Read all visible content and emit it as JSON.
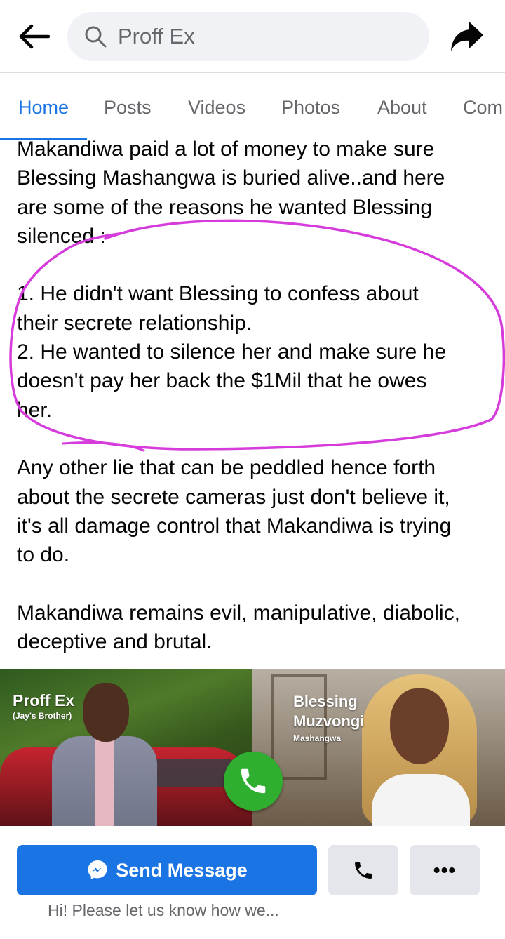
{
  "header": {
    "back_icon": "arrow-left-icon",
    "search_icon": "search-icon",
    "search_text": "Proff Ex",
    "share_icon": "share-arrow-icon"
  },
  "tabs": [
    {
      "label": "Home",
      "active": true
    },
    {
      "label": "Posts",
      "active": false
    },
    {
      "label": "Videos",
      "active": false
    },
    {
      "label": "Photos",
      "active": false
    },
    {
      "label": "About",
      "active": false
    },
    {
      "label": "Com",
      "active": false
    }
  ],
  "post": {
    "intro_lines": [
      "Makandiwa paid a lot of money to make sure",
      "Blessing Mashangwa is buried alive..and here",
      "are some of the reasons he wanted Blessing",
      "silenced :"
    ],
    "list_lines": [
      "1. He didn't want Blessing to confess about",
      "their secrete relationship.",
      "2. He wanted to silence her and make sure he",
      "doesn't pay her back the $1Mil that he owes",
      "her."
    ],
    "para2_lines": [
      "Any other lie that can be peddled hence forth",
      "about the secrete cameras just don't believe it,",
      "it's all damage control that Makandiwa is trying",
      "to do."
    ],
    "para3_lines": [
      "Makandiwa remains evil, manipulative, diabolic,",
      "deceptive and brutal."
    ],
    "annotation_color": "#d63bdb"
  },
  "cover": {
    "left_name": "Proff Ex",
    "left_sub": "(Jay's Brother)",
    "right_name_1": "Blessing",
    "right_name_2": "Muzvongi",
    "right_sub": "Mashangwa",
    "call_icon": "phone-icon",
    "call_color": "#2fae2f"
  },
  "actions": {
    "send_label": "Send Message",
    "send_icon": "messenger-icon",
    "phone_icon": "phone-icon",
    "more_label": "•••",
    "greeting": "Hi! Please let us know how we...",
    "accent": "#1b74e4"
  }
}
